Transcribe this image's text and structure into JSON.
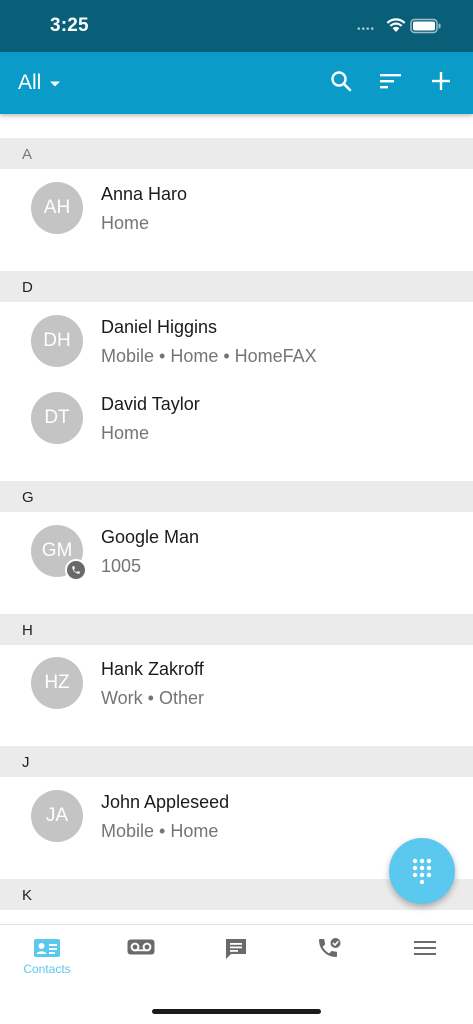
{
  "status_bar": {
    "time": "3:25"
  },
  "header": {
    "filter_label": "All",
    "icons": [
      "search-icon",
      "sort-icon",
      "add-icon"
    ]
  },
  "sections": [
    {
      "letter": "A",
      "contacts": [
        {
          "initials": "AH",
          "name": "Anna Haro",
          "detail": "Home"
        }
      ]
    },
    {
      "letter": "D",
      "contacts": [
        {
          "initials": "DH",
          "name": "Daniel Higgins",
          "detail": "Mobile • Home • HomeFAX"
        },
        {
          "initials": "DT",
          "name": "David Taylor",
          "detail": "Home"
        }
      ]
    },
    {
      "letter": "G",
      "contacts": [
        {
          "initials": "GM",
          "name": "Google Man",
          "detail": "1005",
          "badge": "phone-icon"
        }
      ]
    },
    {
      "letter": "H",
      "contacts": [
        {
          "initials": "HZ",
          "name": "Hank Zakroff",
          "detail": "Work • Other"
        }
      ]
    },
    {
      "letter": "J",
      "contacts": [
        {
          "initials": "JA",
          "name": "John Appleseed",
          "detail": "Mobile • Home"
        }
      ]
    },
    {
      "letter": "K",
      "contacts": []
    }
  ],
  "fab": {
    "icon": "dialpad-icon"
  },
  "bottom_nav": {
    "tabs": [
      {
        "label": "Contacts",
        "icon": "contacts-icon",
        "active": true
      },
      {
        "label": "",
        "icon": "voicemail-icon"
      },
      {
        "label": "",
        "icon": "chat-icon"
      },
      {
        "label": "",
        "icon": "call-history-icon"
      },
      {
        "label": "",
        "icon": "menu-icon"
      }
    ]
  },
  "colors": {
    "status_bar": "#0a5f78",
    "app_bar": "#0a9bc8",
    "accent": "#5bc8ef",
    "avatar": "#c4c4c4",
    "section_header": "#ebebeb"
  }
}
